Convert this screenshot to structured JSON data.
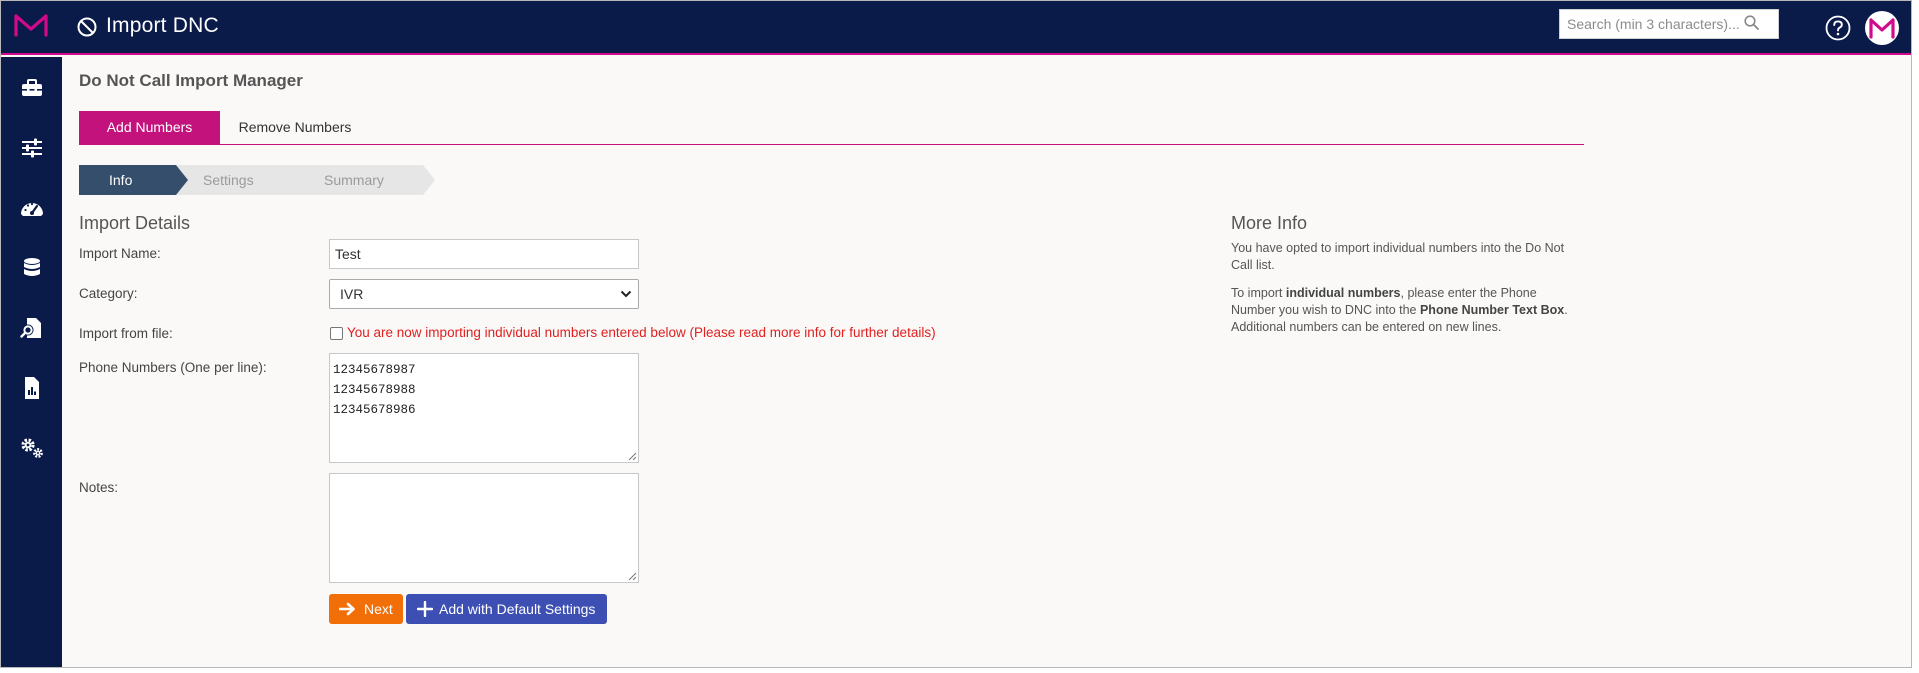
{
  "app": {
    "title": "Import DNC",
    "search_placeholder": "Search (min 3 characters)..."
  },
  "colors": {
    "topbar": "#0a1a49",
    "accent": "#c3127c",
    "next_button": "#f26e07",
    "default_button": "#3e4fb4",
    "error_text": "#e0201f"
  },
  "sidebar": {
    "items": [
      {
        "icon": "toolbox-icon"
      },
      {
        "icon": "sliders-icon"
      },
      {
        "icon": "dashboard-gauge-icon"
      },
      {
        "icon": "database-icon"
      },
      {
        "icon": "file-search-icon"
      },
      {
        "icon": "report-file-icon"
      },
      {
        "icon": "settings-gears-icon"
      }
    ]
  },
  "page": {
    "heading": "Do Not Call Import Manager",
    "tabs": [
      {
        "label": "Add Numbers",
        "active": true
      },
      {
        "label": "Remove Numbers",
        "active": false
      }
    ],
    "steps": [
      "Info",
      "Settings",
      "Summary"
    ],
    "active_step": "Info"
  },
  "form": {
    "section_title": "Import Details",
    "import_name": {
      "label": "Import Name:",
      "value": "Test"
    },
    "category": {
      "label": "Category:",
      "value": "IVR"
    },
    "import_from_file": {
      "label": "Import from file:",
      "checked": false,
      "note": "You are now importing individual numbers entered below (Please read more info for further details)"
    },
    "phone_numbers": {
      "label": "Phone Numbers (One per line):",
      "lines": [
        "12345678987",
        "12345678988",
        "12345678986"
      ]
    },
    "notes": {
      "label": "Notes:",
      "value": ""
    },
    "buttons": {
      "next": "Next",
      "add_default": "Add with Default Settings"
    }
  },
  "more_info": {
    "title": "More Info",
    "p1": "You have opted to import individual numbers into the Do Not Call list.",
    "p2_a": "To import ",
    "p2_b": "individual numbers",
    "p2_c": ", please enter the Phone Number you wish to DNC into the ",
    "p2_d": "Phone Number Text Box",
    "p2_e": ". Additional numbers can be entered on new lines."
  }
}
